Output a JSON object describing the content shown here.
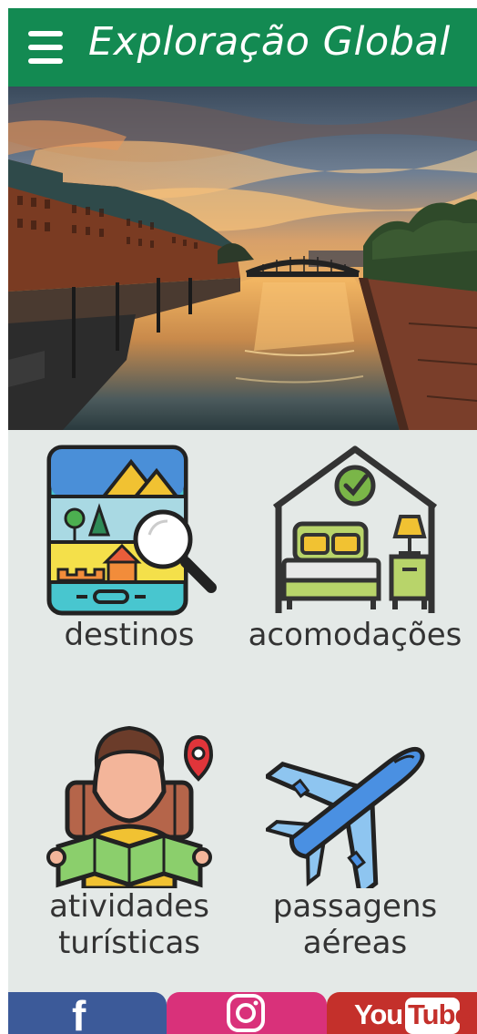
{
  "header": {
    "title": "Exploração Global",
    "menu_icon": "hamburger-menu-icon",
    "background": "#138a52"
  },
  "hero": {
    "image": "canal-sunset-photo"
  },
  "tiles": [
    {
      "label": "destinos",
      "icon": "map-search-icon"
    },
    {
      "label": "acomodações",
      "icon": "bedroom-check-icon"
    },
    {
      "label_line1": "atividades",
      "label_line2": "turísticas",
      "icon": "tourist-map-icon"
    },
    {
      "label_line1": "passagens",
      "label_line2": "aéreas",
      "icon": "airplane-icon"
    }
  ],
  "social": {
    "facebook": {
      "icon": "facebook-icon",
      "glyph": "f",
      "color": "#3c5a99"
    },
    "instagram": {
      "icon": "instagram-icon",
      "color": "#d9317a"
    },
    "youtube": {
      "icon": "youtube-icon",
      "text_you": "You",
      "text_tube": "Tube",
      "color": "#c4302b"
    }
  }
}
